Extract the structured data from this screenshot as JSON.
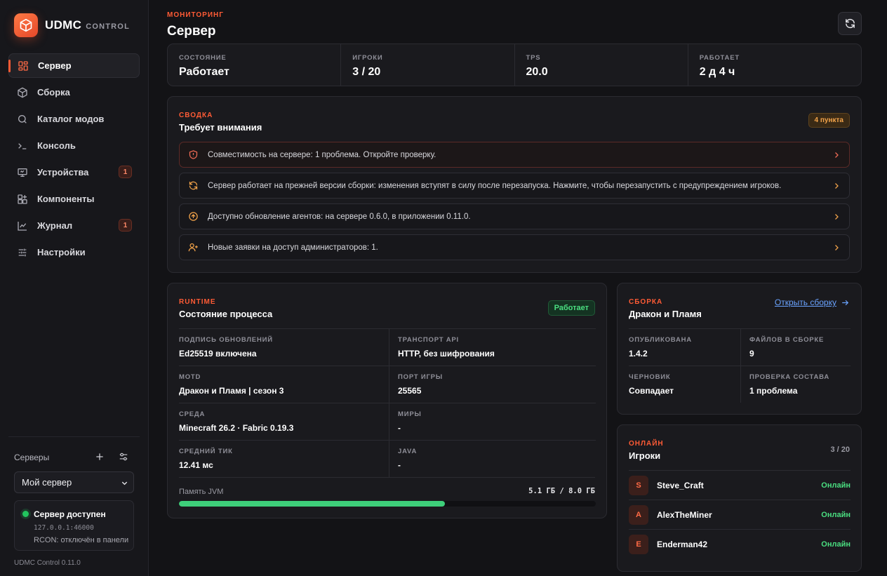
{
  "app": {
    "name": "UDMC",
    "subtitle": "CONTROL",
    "version": "UDMC Control 0.11.0"
  },
  "sidebar": {
    "items": [
      {
        "label": "Сервер",
        "icon": "dashboard-icon"
      },
      {
        "label": "Сборка",
        "icon": "box-icon"
      },
      {
        "label": "Каталог модов",
        "icon": "search-icon"
      },
      {
        "label": "Консоль",
        "icon": "terminal-icon"
      },
      {
        "label": "Устройства",
        "icon": "monitor-icon",
        "badge": "1"
      },
      {
        "label": "Компоненты",
        "icon": "blocks-icon"
      },
      {
        "label": "Журнал",
        "icon": "chart-line-icon",
        "badge": "1"
      },
      {
        "label": "Настройки",
        "icon": "sliders-icon"
      }
    ],
    "servers_label": "Серверы",
    "selected_server": "Мой сервер",
    "status": {
      "title": "Сервер доступен",
      "address": "127.0.0.1:46000",
      "rcon": "RCON: отключён в панели"
    }
  },
  "header": {
    "kicker": "МОНИТОРИНГ",
    "title": "Сервер"
  },
  "stats": [
    {
      "label": "СОСТОЯНИЕ",
      "value": "Работает"
    },
    {
      "label": "ИГРОКИ",
      "value": "3 / 20"
    },
    {
      "label": "TPS",
      "value": "20.0"
    },
    {
      "label": "РАБОТАЕТ",
      "value": "2 д 4 ч"
    }
  ],
  "summary": {
    "kicker": "СВОДКА",
    "title": "Требует внимания",
    "badge": "4 пункта",
    "alerts": [
      {
        "text": "Совместимость на сервере: 1 проблема. Откройте проверку.",
        "icon": "shield-alert-icon"
      },
      {
        "text": "Сервер работает на прежней версии сборки: изменения вступят в силу после перезапуска. Нажмите, чтобы перезапустить с предупреждением игроков.",
        "icon": "refresh-icon"
      },
      {
        "text": "Доступно обновление агентов: на сервере 0.6.0, в приложении 0.11.0.",
        "icon": "arrow-up-circle-icon"
      },
      {
        "text": "Новые заявки на доступ администраторов: 1.",
        "icon": "user-plus-icon"
      }
    ]
  },
  "runtime": {
    "kicker": "RUNTIME",
    "title": "Состояние процесса",
    "badge": "Работает",
    "fields": [
      {
        "label": "ПОДПИСЬ ОБНОВЛЕНИЙ",
        "value": "Ed25519 включена"
      },
      {
        "label": "ТРАНСПОРТ API",
        "value": "HTTP, без шифрования"
      },
      {
        "label": "MOTD",
        "value": "Дракон и Пламя | сезон 3"
      },
      {
        "label": "ПОРТ ИГРЫ",
        "value": "25565"
      },
      {
        "label": "СРЕДА",
        "value": "Minecraft 26.2 · Fabric 0.19.3"
      },
      {
        "label": "МИРЫ",
        "value": "-"
      },
      {
        "label": "СРЕДНИЙ ТИК",
        "value": "12.41 мс"
      },
      {
        "label": "JAVA",
        "value": "-"
      }
    ],
    "memory": {
      "label": "Память JVM",
      "value": "5.1 ГБ / 8.0 ГБ",
      "used_fraction": 0.6375
    }
  },
  "build": {
    "kicker": "СБОРКА",
    "title": "Дракон и Пламя",
    "link": "Открыть сборку",
    "fields": [
      {
        "label": "ОПУБЛИКОВАНА",
        "value": "1.4.2"
      },
      {
        "label": "ФАЙЛОВ В СБОРКЕ",
        "value": "9"
      },
      {
        "label": "ЧЕРНОВИК",
        "value": "Совпадает"
      },
      {
        "label": "ПРОВЕРКА СОСТАВА",
        "value": "1 проблема"
      }
    ]
  },
  "players": {
    "kicker": "ОНЛАЙН",
    "title": "Игроки",
    "count": "3 / 20",
    "list": [
      {
        "initial": "S",
        "name": "Steve_Craft",
        "status": "Онлайн"
      },
      {
        "initial": "A",
        "name": "AlexTheMiner",
        "status": "Онлайн"
      },
      {
        "initial": "E",
        "name": "Enderman42",
        "status": "Онлайн"
      }
    ]
  },
  "colors": {
    "accent": "#ff5b35",
    "success": "#4ade80",
    "warning": "#f2a34a",
    "link": "#6aa3ff",
    "background": "#131316"
  }
}
